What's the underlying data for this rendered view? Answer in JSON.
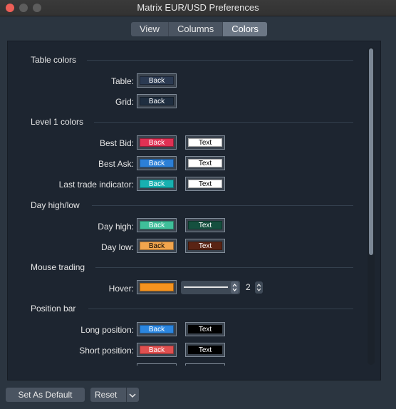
{
  "window": {
    "title": "Matrix EUR/USD Preferences"
  },
  "tabs": [
    "View",
    "Columns",
    "Colors"
  ],
  "active_tab": "Colors",
  "sections": {
    "table_colors": {
      "title": "Table colors",
      "rows": [
        {
          "label": "Table:",
          "back": "Back",
          "back_color": "#2b3a52"
        },
        {
          "label": "Grid:",
          "back": "Back",
          "back_color": "#1f2e40"
        }
      ]
    },
    "level1_colors": {
      "title": "Level 1 colors",
      "rows": [
        {
          "label": "Best Bid:",
          "back": "Back",
          "back_color": "#e03154",
          "text": "Text",
          "text_color": "#ffffff"
        },
        {
          "label": "Best Ask:",
          "back": "Back",
          "back_color": "#2c7fd6",
          "text": "Text",
          "text_color": "#ffffff"
        },
        {
          "label": "Last trade indicator:",
          "back": "Back",
          "back_color": "#18b0b0",
          "text": "Text",
          "text_color": "#ffffff"
        }
      ]
    },
    "day_high_low": {
      "title": "Day high/low",
      "rows": [
        {
          "label": "Day high:",
          "back": "Back",
          "back_color": "#3fbf9a",
          "text": "Text",
          "text_color": "#15503f"
        },
        {
          "label": "Day low:",
          "back": "Back",
          "back_color": "#f2a54d",
          "text": "Text",
          "text_color": "#5a2414"
        }
      ]
    },
    "mouse_trading": {
      "title": "Mouse trading",
      "rows": [
        {
          "label": "Hover:",
          "back_color": "#f5931f",
          "thickness": "2"
        }
      ]
    },
    "position_bar": {
      "title": "Position bar",
      "rows": [
        {
          "label": "Long position:",
          "back": "Back",
          "back_color": "#2b86e0",
          "text": "Text",
          "text_color": "#000000"
        },
        {
          "label": "Short position:",
          "back": "Back",
          "back_color": "#e05050",
          "text": "Text",
          "text_color": "#000000"
        }
      ]
    }
  },
  "footer": {
    "set_default": "Set As Default",
    "reset": "Reset"
  }
}
